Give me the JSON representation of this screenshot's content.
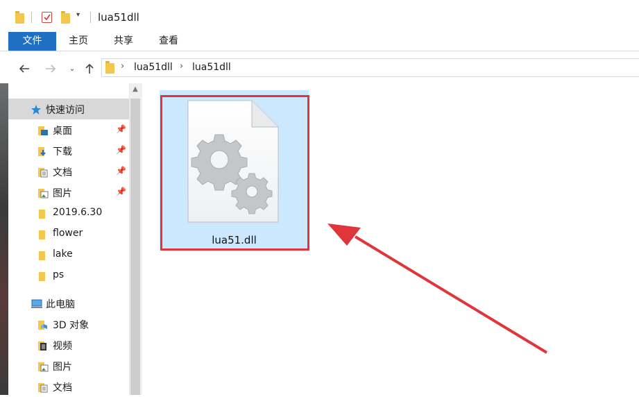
{
  "window": {
    "title": "lua51dll"
  },
  "ribbon": {
    "tabs": [
      "文件",
      "主页",
      "共享",
      "查看"
    ]
  },
  "address": {
    "breadcrumbs": [
      "lua51dll",
      "lua51dll"
    ]
  },
  "nav": {
    "quick_access": "快速访问",
    "quick_items": [
      {
        "label": "桌面",
        "pinned": true
      },
      {
        "label": "下载",
        "pinned": true
      },
      {
        "label": "文档",
        "pinned": true
      },
      {
        "label": "图片",
        "pinned": true
      },
      {
        "label": "2019.6.30",
        "pinned": false
      },
      {
        "label": "flower",
        "pinned": false
      },
      {
        "label": "lake",
        "pinned": false
      },
      {
        "label": "ps",
        "pinned": false
      }
    ],
    "this_pc": "此电脑",
    "pc_items": [
      {
        "label": "3D 对象"
      },
      {
        "label": "视频"
      },
      {
        "label": "图片"
      },
      {
        "label": "文档"
      }
    ]
  },
  "content": {
    "file": {
      "name": "lua51.dll",
      "icon": "dll-gear-file-icon",
      "selected": true
    }
  },
  "colors": {
    "file_tab": "#1f6fc4",
    "selection": "#cce8ff",
    "annotation": "#e0353b"
  }
}
